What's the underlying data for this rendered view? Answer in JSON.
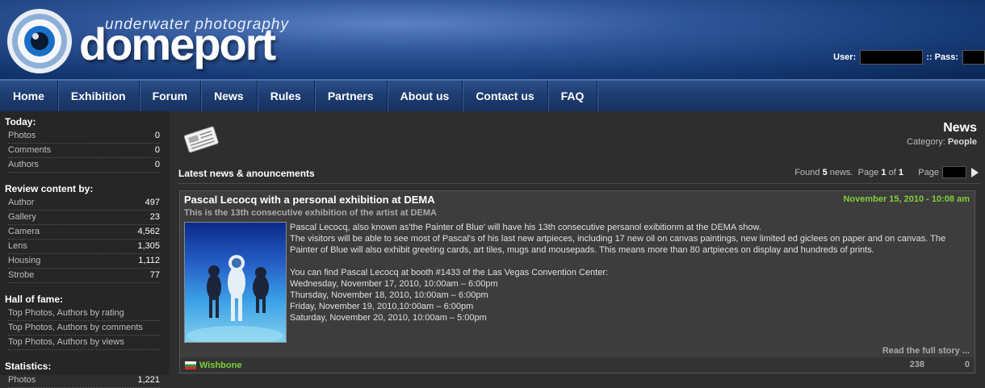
{
  "header": {
    "logo_subtitle": "underwater photography",
    "logo_title": "domeport",
    "user_label": "User:",
    "pass_label": ":: Pass:"
  },
  "nav": [
    "Home",
    "Exhibition",
    "Forum",
    "News",
    "Rules",
    "Partners",
    "About us",
    "Contact us",
    "FAQ"
  ],
  "sidebar": {
    "today": {
      "title": "Today:",
      "rows": [
        {
          "label": "Photos",
          "value": "0"
        },
        {
          "label": "Comments",
          "value": "0"
        },
        {
          "label": "Authors",
          "value": "0"
        }
      ]
    },
    "review": {
      "title": "Review content by:",
      "rows": [
        {
          "label": "Author",
          "value": "497"
        },
        {
          "label": "Gallery",
          "value": "23"
        },
        {
          "label": "Camera",
          "value": "4,562"
        },
        {
          "label": "Lens",
          "value": "1,305"
        },
        {
          "label": "Housing",
          "value": "1,112"
        },
        {
          "label": "Strobe",
          "value": "77"
        }
      ]
    },
    "hall": {
      "title": "Hall of fame:",
      "links": [
        "Top Photos, Authors by rating",
        "Top Photos, Authors by comments",
        "Top Photos, Authors by views"
      ]
    },
    "stats": {
      "title": "Statistics:",
      "rows": [
        {
          "label": "Photos",
          "value": "1,221"
        }
      ]
    }
  },
  "main": {
    "title": "News",
    "category_label": "Category:",
    "category_value": "People",
    "latest": "Latest news & anouncements",
    "found_pre": "Found",
    "found_count": "5",
    "found_post": "news.",
    "page_pre": "Page",
    "page_num": "1",
    "page_of": "of",
    "page_total": "1",
    "page_label": "Page"
  },
  "article": {
    "title": "Pascal Lecocq with a personal exhibition at DEMA",
    "date": "November 15, 2010 - 10:08 am",
    "subtitle": "This is the 13th consecutive exhibition of the artist at DEMA",
    "paragraphs": [
      "Pascal Lecocq, also known as'the Painter of Blue' will have his 13th consecutive persanol exibitionm at the DEMA show.",
      "The visitors will be able to see most of Pascal's of his last new artpieces, including 17 new oil on canvas paintings, new limited ed giclees on paper and on canvas. The Painter of Blue will also exhibit greeting cards, art tiles, mugs and mousepads. This means more than 80 artpieces on display and hundreds of prints.",
      "",
      "You can find Pascal Lecocq at booth #1433 of the Las Vegas Convention Center:",
      "Wednesday, November 17, 2010, 10:00am – 6:00pm",
      "Thursday, November 18, 2010, 10:00am – 6:00pm",
      "Friday, November 19, 2010,10:00am – 6:00pm",
      "Saturday, November 20, 2010, 10:00am – 5:00pm"
    ],
    "read_more": "Read the full story ...",
    "author": "Wishbone",
    "views": "238",
    "comments": "0"
  }
}
